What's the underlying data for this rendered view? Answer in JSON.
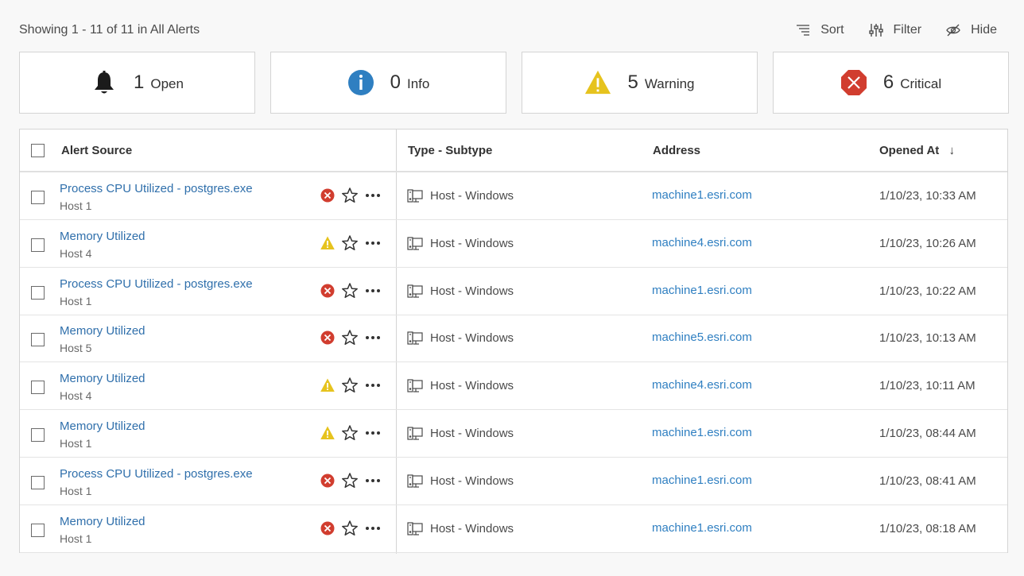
{
  "summary": {
    "showing_text": "Showing 1 - 11 of 11 in All Alerts"
  },
  "toolbar": {
    "sort_label": "Sort",
    "filter_label": "Filter",
    "hide_label": "Hide"
  },
  "cards": [
    {
      "count": "1",
      "label": "Open",
      "icon": "bell-icon"
    },
    {
      "count": "0",
      "label": "Info",
      "icon": "info-icon",
      "color": "#2f7fc1"
    },
    {
      "count": "5",
      "label": "Warning",
      "icon": "warning-icon",
      "color": "#e6c31e"
    },
    {
      "count": "6",
      "label": "Critical",
      "icon": "critical-icon",
      "color": "#d13d2f"
    }
  ],
  "table": {
    "columns": [
      "Alert Source",
      "Type - Subtype",
      "Address",
      "Opened At"
    ],
    "sort_indicator": "↓",
    "rows": [
      {
        "title": "Process CPU Utilized - postgres.exe",
        "host": "Host 1",
        "severity": "critical",
        "type": "Host - Windows",
        "address": "machine1.esri.com",
        "opened": "1/10/23, 10:33 AM"
      },
      {
        "title": "Memory Utilized",
        "host": "Host 4",
        "severity": "warning",
        "type": "Host - Windows",
        "address": "machine4.esri.com",
        "opened": "1/10/23, 10:26 AM"
      },
      {
        "title": "Process CPU Utilized - postgres.exe",
        "host": "Host 1",
        "severity": "critical",
        "type": "Host - Windows",
        "address": "machine1.esri.com",
        "opened": "1/10/23, 10:22 AM"
      },
      {
        "title": "Memory Utilized",
        "host": "Host 5",
        "severity": "critical",
        "type": "Host - Windows",
        "address": "machine5.esri.com",
        "opened": "1/10/23, 10:13 AM"
      },
      {
        "title": "Memory Utilized",
        "host": "Host 4",
        "severity": "warning",
        "type": "Host - Windows",
        "address": "machine4.esri.com",
        "opened": "1/10/23, 10:11 AM"
      },
      {
        "title": "Memory Utilized",
        "host": "Host 1",
        "severity": "warning",
        "type": "Host - Windows",
        "address": "machine1.esri.com",
        "opened": "1/10/23, 08:44 AM"
      },
      {
        "title": "Process CPU Utilized - postgres.exe",
        "host": "Host 1",
        "severity": "critical",
        "type": "Host - Windows",
        "address": "machine1.esri.com",
        "opened": "1/10/23, 08:41 AM"
      },
      {
        "title": "Memory Utilized",
        "host": "Host 1",
        "severity": "critical",
        "type": "Host - Windows",
        "address": "machine1.esri.com",
        "opened": "1/10/23, 08:18 AM"
      }
    ]
  }
}
